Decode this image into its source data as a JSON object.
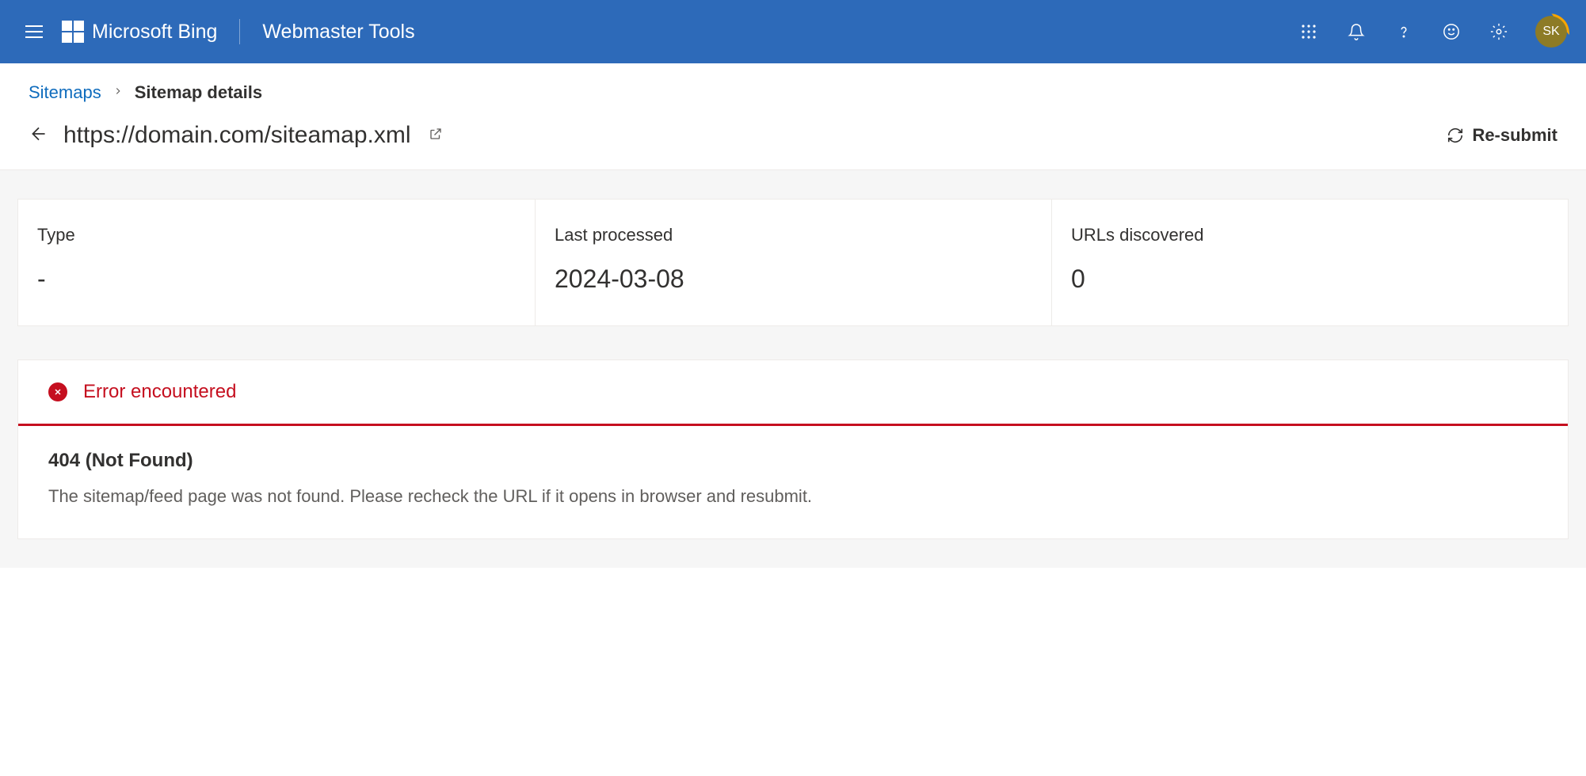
{
  "header": {
    "brand": "Microsoft Bing",
    "tool": "Webmaster Tools",
    "avatar_initials": "SK"
  },
  "breadcrumb": {
    "parent": "Sitemaps",
    "current": "Sitemap details"
  },
  "page": {
    "url": "https://domain.com/siteamap.xml",
    "resubmit_label": "Re-submit"
  },
  "stats": {
    "type_label": "Type",
    "type_value": "-",
    "processed_label": "Last processed",
    "processed_value": "2024-03-08",
    "urls_label": "URLs discovered",
    "urls_value": "0"
  },
  "error": {
    "heading": "Error encountered",
    "code": "404 (Not Found)",
    "description": "The sitemap/feed page was not found. Please recheck the URL if it opens in browser and resubmit."
  }
}
